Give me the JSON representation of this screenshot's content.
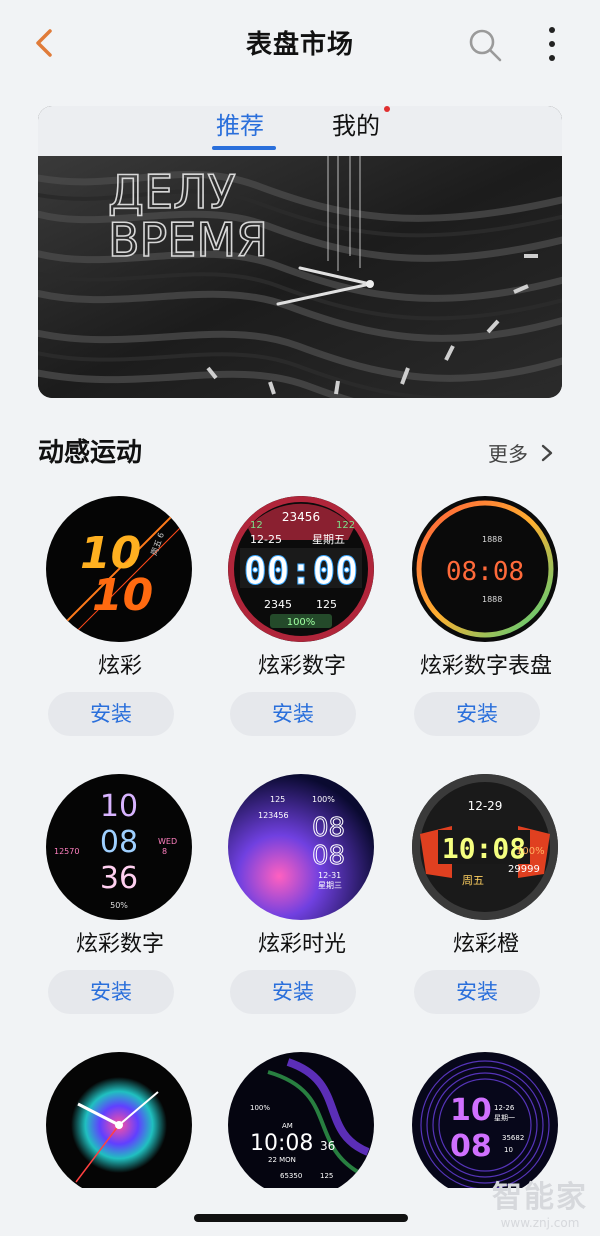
{
  "header": {
    "title": "表盘市场",
    "back_icon": "chevron-left-icon",
    "search_icon": "search-icon",
    "more_icon": "more-vertical-icon",
    "accent": "#e07b39"
  },
  "tabs": [
    {
      "label": "推荐",
      "active": true
    },
    {
      "label": "我的",
      "active": false,
      "has_badge": true
    }
  ],
  "banner": {
    "line1": "ДЕЛУ",
    "line2": "ВРЕМЯ"
  },
  "section": {
    "title": "动感运动",
    "more_label": "更多"
  },
  "watches": [
    {
      "name": "炫彩",
      "install_label": "安装",
      "face": {
        "l1": "10",
        "l2": "10",
        "side": "周五 6"
      }
    },
    {
      "name": "炫彩数字",
      "install_label": "安装",
      "face": {
        "top": "23456",
        "left_num": "12",
        "right_num": "122",
        "date": "12-25",
        "weekday": "星期五",
        "time": "00:00",
        "b_left": "2345",
        "b_right": "125",
        "battery": "100%"
      }
    },
    {
      "name": "炫彩数字表盘",
      "install_label": "安装",
      "face": {
        "top": "1888",
        "time": "08:08",
        "bottom": "1888"
      }
    },
    {
      "name": "炫彩数字",
      "install_label": "安装",
      "face": {
        "h": "10",
        "m": "08",
        "s": "36",
        "left": "12570",
        "wd": "WED",
        "day": "8",
        "bat": "50%"
      }
    },
    {
      "name": "炫彩时光",
      "install_label": "安装",
      "face": {
        "t1": "125",
        "t2": "100%",
        "steps": "123456",
        "h": "08",
        "m": "08",
        "date": "12-31",
        "weekday": "星期三"
      }
    },
    {
      "name": "炫彩橙",
      "install_label": "安装",
      "face": {
        "date": "12-29",
        "time": "10:08",
        "weekday": "周五",
        "pct": "100%",
        "steps": "29999"
      }
    },
    {
      "name": "",
      "install_label": "",
      "face": {}
    },
    {
      "name": "",
      "install_label": "",
      "face": {
        "pct": "100%",
        "ampm": "AM",
        "time": "10:08",
        "sec": "36",
        "date": "22 MON",
        "steps": "65350",
        "hr": "125"
      }
    },
    {
      "name": "",
      "install_label": "",
      "face": {
        "h": "10",
        "m": "08",
        "date": "12-26",
        "weekday": "星期一",
        "steps": "35682",
        "num": "10"
      }
    }
  ],
  "watermark": {
    "main": "智能家",
    "sub": "www.znj.com"
  },
  "colors": {
    "primary_blue": "#2a6fdb",
    "badge_red": "#e03030",
    "background": "#f1f3f5"
  }
}
